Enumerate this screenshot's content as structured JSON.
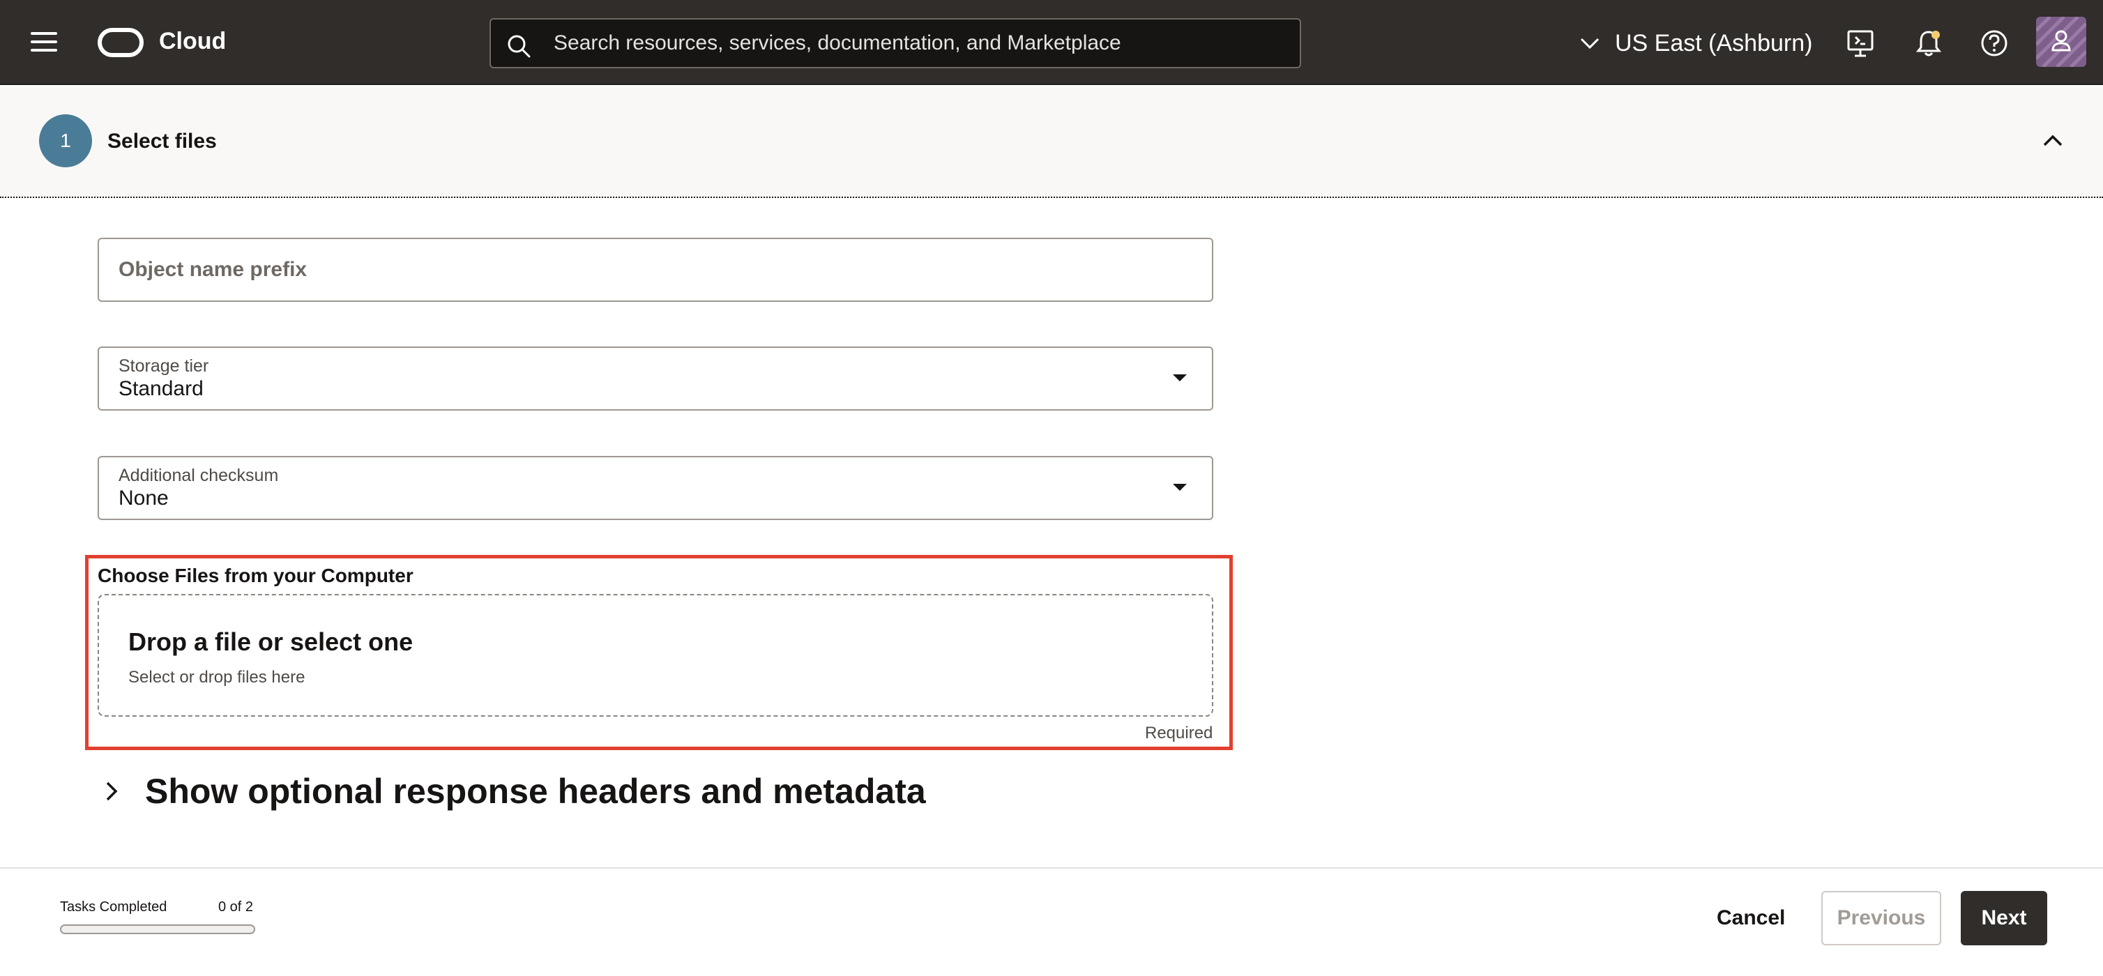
{
  "header": {
    "brand": "Cloud",
    "search_placeholder": "Search resources, services, documentation, and Marketplace",
    "region": "US East (Ashburn)"
  },
  "section": {
    "step_number": "1",
    "title": "Select files"
  },
  "form": {
    "prefix_placeholder": "Object name prefix",
    "storage_tier": {
      "label": "Storage tier",
      "value": "Standard"
    },
    "checksum": {
      "label": "Additional checksum",
      "value": "None"
    },
    "upload": {
      "label": "Choose Files from your Computer",
      "drop_title": "Drop a file or select one",
      "drop_subtitle": "Select or drop files here",
      "required": "Required"
    },
    "optional_toggle": "Show optional response headers and metadata"
  },
  "footer": {
    "tasks_label": "Tasks Completed",
    "tasks_count": "0 of 2",
    "tasks_progress": 0,
    "cancel": "Cancel",
    "previous": "Previous",
    "next": "Next"
  },
  "colors": {
    "header_bg": "#312d2a",
    "highlight": "#e1402f",
    "step_circle": "#4b7c97",
    "primary_button": "#312d2a"
  }
}
